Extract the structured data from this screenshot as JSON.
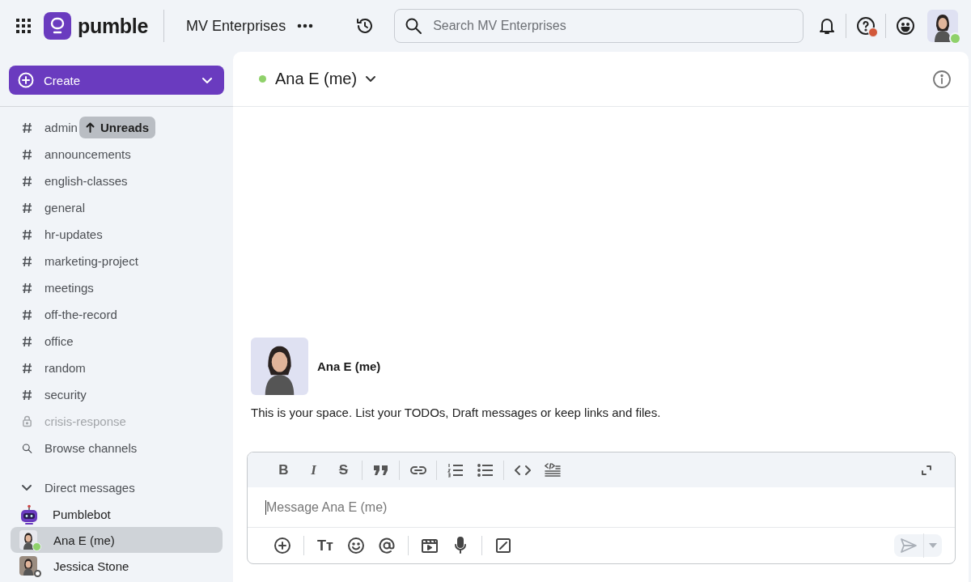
{
  "topbar": {
    "logo": "pumble",
    "workspace": "MV Enterprises",
    "search": {
      "placeholder": "Search MV Enterprises"
    },
    "help_alert": true,
    "user_online": true
  },
  "sidebar": {
    "create_button": "Create",
    "unreads_pill": "Unreads",
    "channels": [
      {
        "name": "admin",
        "kind": "public"
      },
      {
        "name": "announcements",
        "kind": "public"
      },
      {
        "name": "english-classes",
        "kind": "public"
      },
      {
        "name": "general",
        "kind": "public"
      },
      {
        "name": "hr-updates",
        "kind": "public"
      },
      {
        "name": "marketing-project",
        "kind": "public"
      },
      {
        "name": "meetings",
        "kind": "public"
      },
      {
        "name": "off-the-record",
        "kind": "public"
      },
      {
        "name": "office",
        "kind": "public"
      },
      {
        "name": "random",
        "kind": "public"
      },
      {
        "name": "security",
        "kind": "public"
      },
      {
        "name": "crisis-response",
        "kind": "private"
      }
    ],
    "browse": "Browse channels",
    "dm_section": {
      "label": "Direct messages",
      "expanded": true
    },
    "direct_messages": [
      {
        "name": "Pumblebot",
        "kind": "bot",
        "selected": false
      },
      {
        "name": "Ana E (me)",
        "kind": "person",
        "selected": true,
        "online": true
      },
      {
        "name": "Jessica Stone",
        "kind": "person",
        "selected": false,
        "online": false
      }
    ]
  },
  "chat": {
    "header": {
      "title": "Ana E (me)",
      "online": true
    },
    "intro": {
      "name": "Ana E (me)",
      "text": "This is your space. List your TODOs, Draft messages or keep links and files."
    },
    "composer": {
      "format_tools": [
        {
          "kind": "bold",
          "glyph": "B"
        },
        {
          "kind": "italic",
          "glyph": "I"
        },
        {
          "kind": "strike",
          "glyph": "S"
        },
        {
          "kind": "quote"
        },
        {
          "kind": "link"
        },
        {
          "kind": "ordered-list"
        },
        {
          "kind": "bullet-list"
        },
        {
          "kind": "code"
        },
        {
          "kind": "code-block"
        }
      ],
      "placeholder": "Message Ana E (me)",
      "actions": [
        {
          "kind": "attach"
        },
        {
          "kind": "text-style",
          "glyph": "Tт"
        },
        {
          "kind": "emoji"
        },
        {
          "kind": "mention"
        },
        {
          "kind": "video"
        },
        {
          "kind": "voice"
        },
        {
          "kind": "slash"
        }
      ],
      "send_enabled": false
    }
  }
}
